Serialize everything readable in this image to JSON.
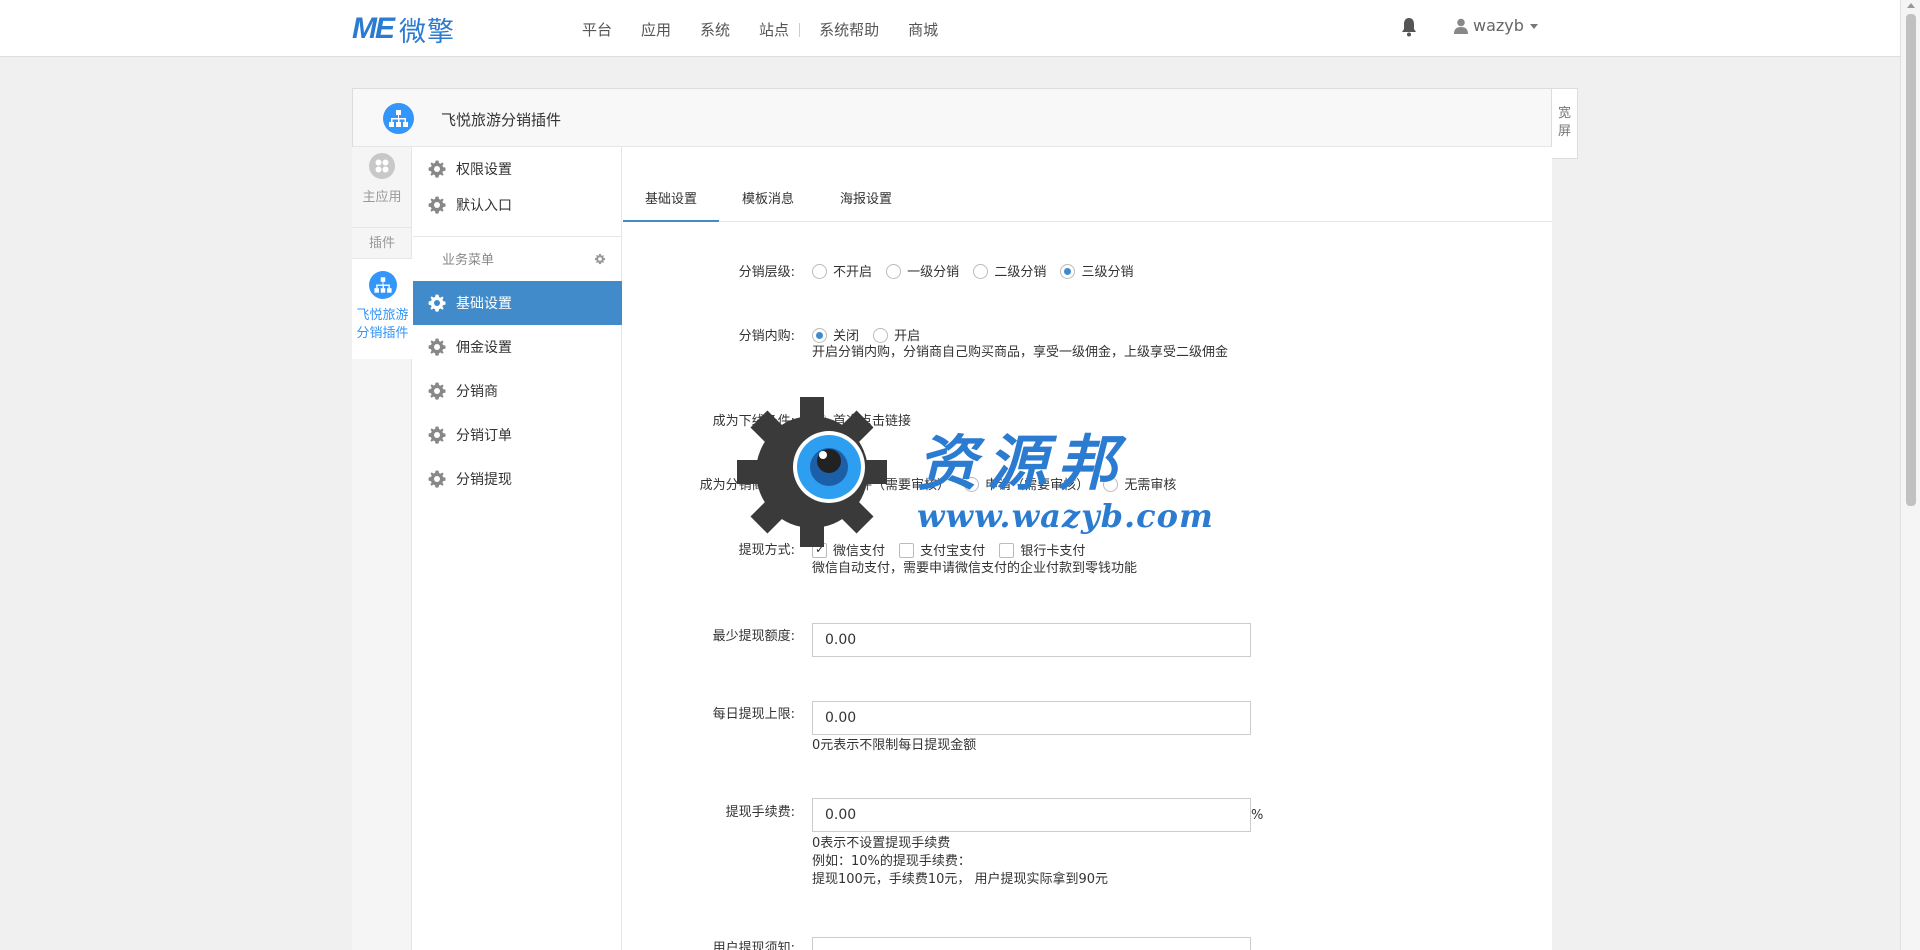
{
  "brand": {
    "logo_text": "ME",
    "logo_cn": "微擎"
  },
  "nav": {
    "items": [
      "平台",
      "应用",
      "系统",
      "站点",
      "系统帮助",
      "商城"
    ]
  },
  "user": {
    "name": "wazyb"
  },
  "header": {
    "title": "飞悦旅游分销插件",
    "wide_label": "宽屏"
  },
  "leftcol": {
    "home": "主应用",
    "plugin_label": "插件",
    "active_plugin": "飞悦旅游分销插件"
  },
  "menu": {
    "top_items": [
      "权限设置",
      "默认入口"
    ],
    "group_label": "业务菜单",
    "items": [
      "基础设置",
      "佣金设置",
      "分销商",
      "分销订单",
      "分销提现"
    ],
    "active_index": 0
  },
  "tabs": [
    "基础设置",
    "模板消息",
    "海报设置"
  ],
  "form": {
    "level": {
      "label": "分销层级:",
      "options": [
        "不开启",
        "一级分销",
        "二级分销",
        "三级分销"
      ],
      "selected": 3
    },
    "self_buy": {
      "label": "分销内购:",
      "options": [
        "关闭",
        "开启"
      ],
      "selected": 0,
      "help": "开启分销内购，分销商自己购买商品，享受一级佣金，上级享受二级佣金"
    },
    "downline": {
      "label": "成为下线条件:",
      "option": "首次点击链接"
    },
    "become": {
      "label": "成为分销商条件:",
      "options": [
        "无条件（需要审核）",
        "申请（需要审核）",
        "无需审核"
      ]
    },
    "withdraw_method": {
      "label": "提现方式:",
      "options": [
        "微信支付",
        "支付宝支付",
        "银行卡支付"
      ],
      "checked": [
        true,
        false,
        false
      ],
      "help": "微信自动支付，需要申请微信支付的企业付款到零钱功能"
    },
    "min_withdraw": {
      "label": "最少提现额度:",
      "value": "0.00"
    },
    "daily_limit": {
      "label": "每日提现上限:",
      "value": "0.00",
      "help": "0元表示不限制每日提现金额"
    },
    "fee": {
      "label": "提现手续费:",
      "value": "0.00",
      "suffix": "%",
      "help1": "0表示不设置提现手续费",
      "help2": "例如：10%的提现手续费：",
      "help3": "提现100元，手续费10元，  用户提现实际拿到90元"
    },
    "notice": {
      "label": "用户提现须知:"
    }
  },
  "watermark": {
    "text": "资源邦",
    "url": "www.wazyb.com"
  },
  "colors": {
    "primary": "#428bca",
    "brand": "#2b7bd0",
    "accent": "#3296fa"
  }
}
